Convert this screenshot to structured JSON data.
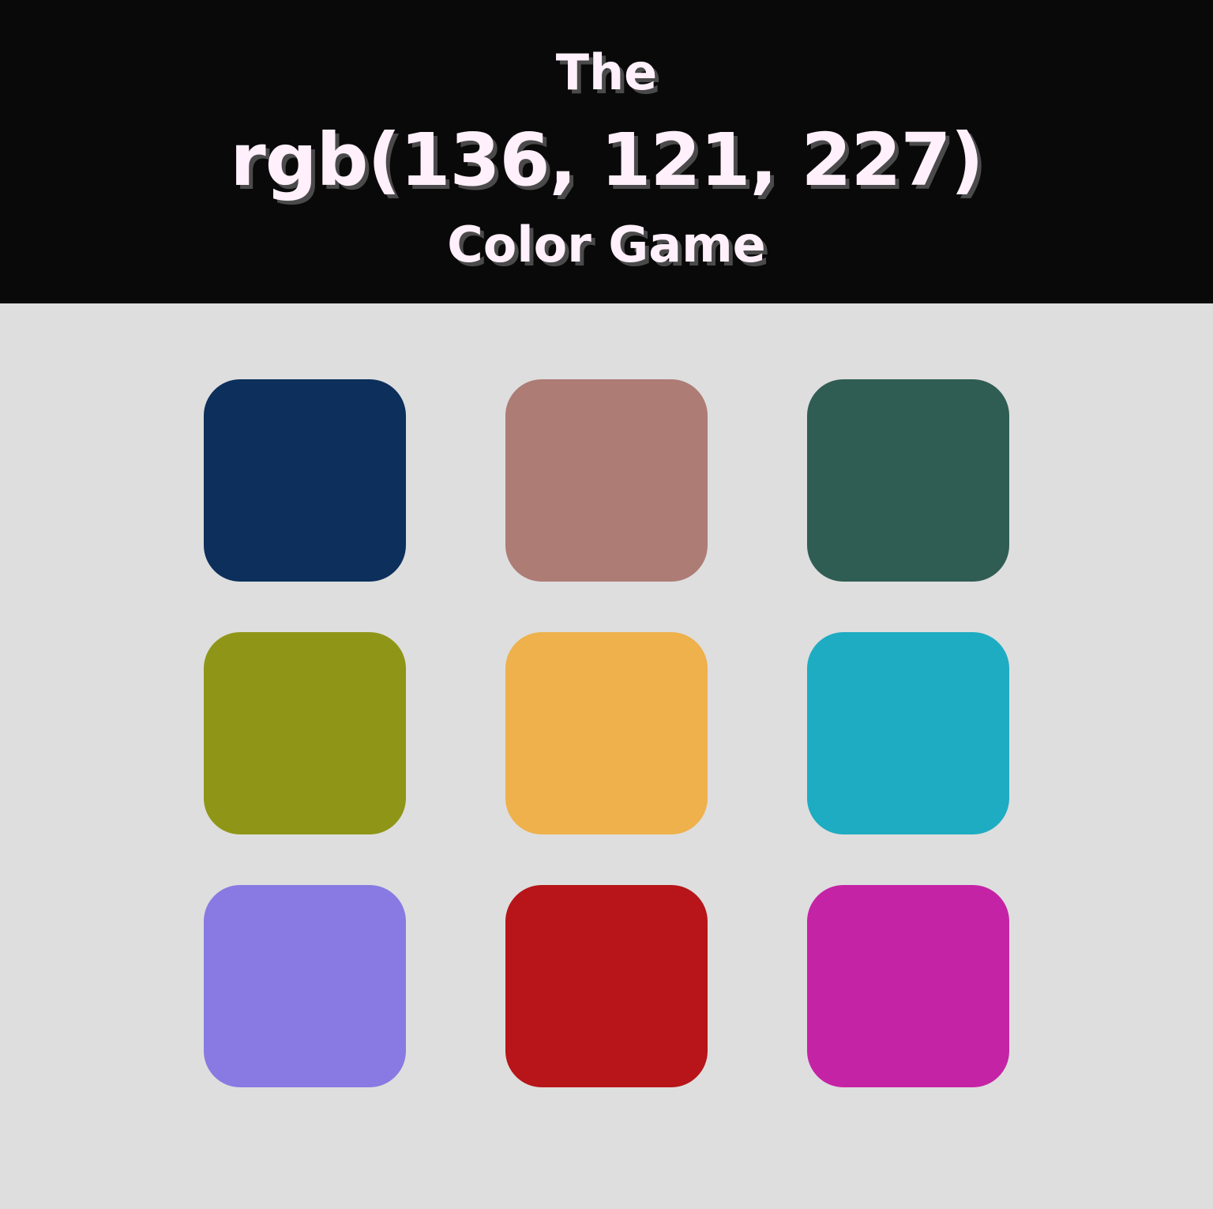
{
  "header": {
    "line1": "The",
    "target_rgb": "rgb(136, 121, 227)",
    "line3": "Color Game",
    "background_color": "#090909",
    "text_color": "#fff0fb",
    "shadow_color": "#4a4a4a"
  },
  "board": {
    "background_color": "#dedede",
    "squares": [
      {
        "color": "#0c2f5b"
      },
      {
        "color": "#ad7c75"
      },
      {
        "color": "#305d53"
      },
      {
        "color": "#8f9617"
      },
      {
        "color": "#eeb14b"
      },
      {
        "color": "#1eacc2"
      },
      {
        "color": "#887ae2"
      },
      {
        "color": "#b71519"
      },
      {
        "color": "#c523a5"
      }
    ]
  }
}
